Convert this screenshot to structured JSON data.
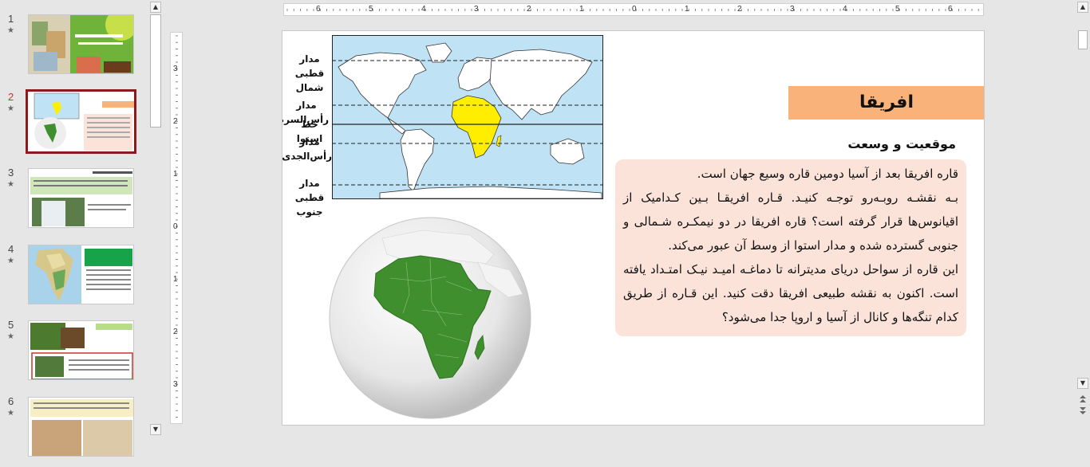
{
  "thumbnails": [
    {
      "number": "1",
      "star": "★",
      "selected": false
    },
    {
      "number": "2",
      "star": "★",
      "selected": true
    },
    {
      "number": "3",
      "star": "★",
      "selected": false
    },
    {
      "number": "4",
      "star": "★",
      "selected": false
    },
    {
      "number": "5",
      "star": "★",
      "selected": false
    },
    {
      "number": "6",
      "star": "★",
      "selected": false
    }
  ],
  "scroll_arrows": {
    "up": "▲",
    "down": "▼"
  },
  "ruler_horizontal": [
    "6",
    "5",
    "4",
    "3",
    "2",
    "1",
    "0",
    "1",
    "2",
    "3",
    "4",
    "5",
    "6"
  ],
  "ruler_vertical": [
    "3",
    "2",
    "1",
    "0",
    "1",
    "2",
    "3"
  ],
  "slide": {
    "title": "افریقا",
    "subtitle": "موقعیت و وسعت",
    "paragraphs": [
      "قاره افریقا بعد از آسیا دومین قاره وسیع جهان است.",
      "بـه نقشـه روبـه‌رو توجـه کنیـد. قـاره افریقـا بـین کـدامیک از اقیانوس‌ها قرار گرفته است؟ قاره افریقا در دو نیمکـره شـمالی و جنوبی گسترده شده و مدار استوا از وسط آن عبور می‌کند.",
      "این قاره از سواحل دریای مدیترانه تا دماغـه امیـد نیـک امتـداد یافته است. اکنون به نقشه طبیعی افریقا دقت کنید. این قـاره از طریق کدام تنگه‌ها و کانال از آسیا و اروپا جدا می‌شود؟"
    ],
    "map_labels": {
      "arctic_circle": "مدار قطبی شمال",
      "tropic_cancer": "مدار رأس‌السرطان",
      "equator": "خط استوا",
      "tropic_capricorn": "مدار رأس‌الجدی",
      "antarctic_circle": "مدار قطبی جنوب"
    }
  },
  "colors": {
    "ocean": "#bfe3f5",
    "africa_highlight": "#ffee00",
    "africa_globe": "#3f8f2e",
    "title_bg": "#f8b27a",
    "textbox_bg": "#fbe3da",
    "selected_border": "#8b1a1a"
  }
}
